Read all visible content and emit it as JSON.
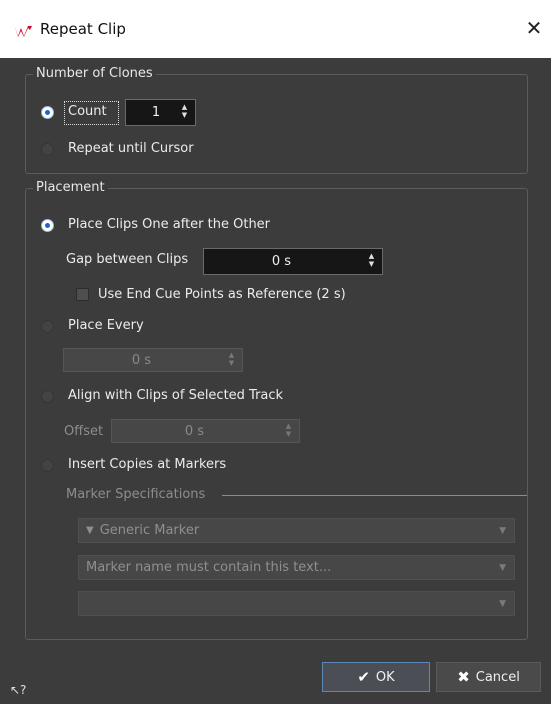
{
  "window": {
    "title": "Repeat Clip"
  },
  "clones": {
    "group_title": "Number of Clones",
    "count_label": "Count",
    "count_value": "1",
    "repeat_label": "Repeat until Cursor"
  },
  "placement": {
    "group_title": "Placement",
    "one_after_label": "Place Clips One after the Other",
    "gap_label": "Gap between Clips",
    "gap_value": "0 s",
    "use_end_cue_label": "Use End Cue Points as Reference (2 s)",
    "place_every_label": "Place Every",
    "place_every_value": "0 s",
    "align_label": "Align with Clips of Selected Track",
    "offset_label": "Offset",
    "offset_value": "0 s",
    "insert_markers_label": "Insert Copies at Markers",
    "marker_spec_label": "Marker Specifications",
    "marker_type_value": "Generic Marker",
    "marker_name_value": "Marker name must contain this text...",
    "marker_third_value": ""
  },
  "buttons": {
    "ok": "OK",
    "cancel": "Cancel"
  },
  "colors": {
    "accent": "#1f66c2",
    "background": "#3c3c3c"
  }
}
